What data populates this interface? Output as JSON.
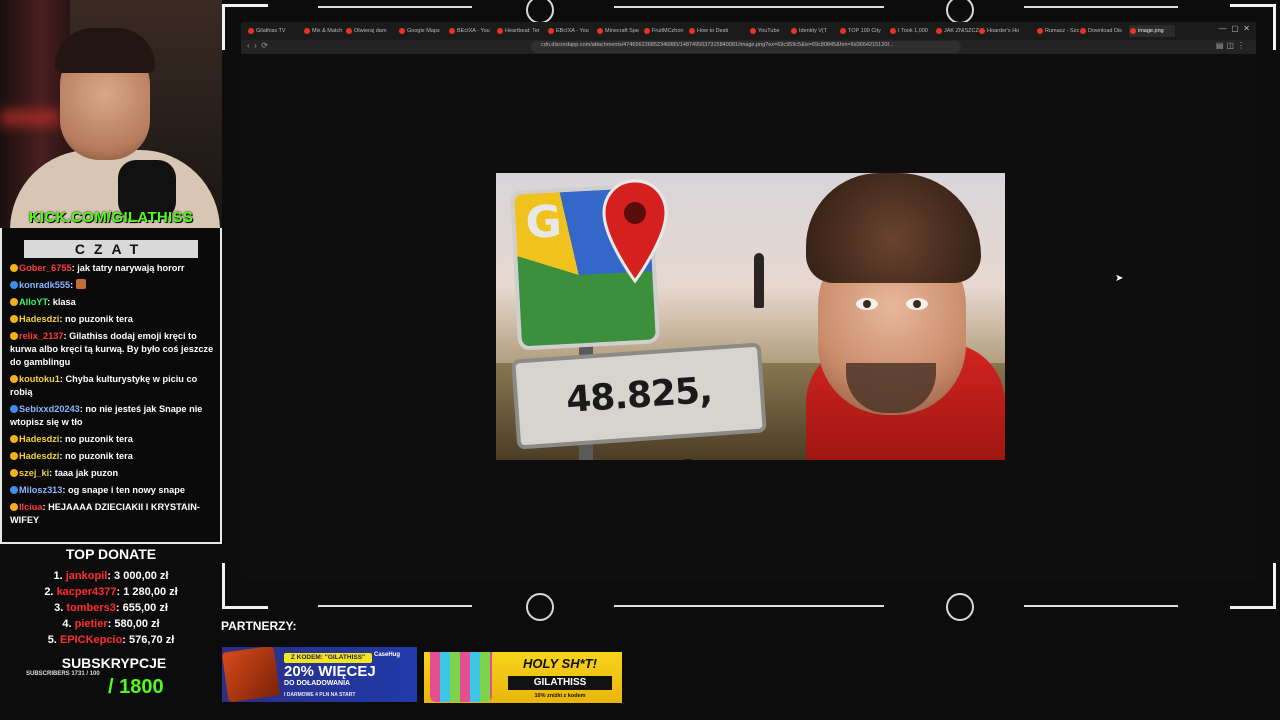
{
  "webcam": {
    "url": "KICK.COM/GILATHISS"
  },
  "chat": {
    "title": "CZAT",
    "messages": [
      {
        "user": "Gober_6755",
        "user_color": "red",
        "text": "jak tatry narywają hororr"
      },
      {
        "user": "konradk555",
        "user_color": "blue",
        "text": ""
      },
      {
        "user": "AlloYT",
        "user_color": "green",
        "text": "klasa"
      },
      {
        "user": "Hadesdzi",
        "user_color": "yellow",
        "text": "no puzonik tera"
      },
      {
        "user": "relix_2137",
        "user_color": "red",
        "text": "Gilathiss dodaj emoji kręci to kurwa albo kręci tą kurwą. By było coś jeszcze do gamblingu"
      },
      {
        "user": "koutoku1",
        "user_color": "yellow",
        "text": "Chyba kulturystykę w piciu co robią"
      },
      {
        "user": "Sebixxd20243",
        "user_color": "blue",
        "text": "no nie jesteś jak Snape nie wtopisz się w tło"
      },
      {
        "user": "Hadesdzi",
        "user_color": "yellow",
        "text": "no puzonik tera"
      },
      {
        "user": "Hadesdzi",
        "user_color": "yellow",
        "text": "no puzonik tera"
      },
      {
        "user": "szej_ki",
        "user_color": "yellow",
        "text": "taaa jak puzon"
      },
      {
        "user": "Milosz313",
        "user_color": "blue",
        "text": "og snape i ten nowy snape"
      },
      {
        "user": "llciua",
        "user_color": "red",
        "text": "HEJAAAA DZIECIAKII I KRYSTAIN-WIFEY"
      }
    ]
  },
  "top_donate": {
    "title": "TOP DONATE",
    "donors": [
      {
        "rank": "1.",
        "name": "jankopil",
        "amount": "3 000,00 zł"
      },
      {
        "rank": "2.",
        "name": "kacper4377",
        "amount": "1 280,00 zł"
      },
      {
        "rank": "3.",
        "name": "tombers3",
        "amount": "655,00 zł"
      },
      {
        "rank": "4.",
        "name": "pietier",
        "amount": "580,00 zł"
      },
      {
        "rank": "5.",
        "name": "EPICKepcio",
        "amount": "576,70 zł"
      }
    ]
  },
  "subs": {
    "title": "SUBSKRYPCJE",
    "small": "SUBSCRIBERS 1731 / 100",
    "goal": "/ 1800"
  },
  "browser": {
    "tabs": [
      "Gilathiss TV",
      "Mix & Match",
      "Otwieraj dam",
      "Google Maps",
      "BEcIXA - You",
      "Heartbeat: Ter",
      "EBcIXA - You",
      "Minecraft Spe",
      "FruitMCzhon",
      "How to Desti",
      "YouTube",
      "Identity V(T",
      "TOP 100 City",
      "I Took 1,000",
      "JAK ZNISZCZ",
      "Hoarder's Ho",
      "Rumacz - Szc",
      "Download Dis",
      "image.png"
    ],
    "url": "cdn.discordapp.com/attachments/474656236852346880/1487495637315840081/image.png?ex=69c959c5&is=69c80845&hm=6d3664215120f..."
  },
  "thumbnail": {
    "g_letter": "G",
    "coordinates": "48.825, 2.198"
  },
  "partners": {
    "label": "PARTNERZY:",
    "banner1": {
      "code": "Z KODEM: \"GILATHISS\"",
      "headline": "20% WIĘCEJ",
      "line2": "DO DOŁADOWANIA",
      "line3": "I DARMOWE 4 PLN NA START",
      "brand": "CaseHug"
    },
    "banner2": {
      "title": "HOLY SH*T!",
      "code": "GILATHISS",
      "sub": "10% zniżki z kodem"
    }
  }
}
